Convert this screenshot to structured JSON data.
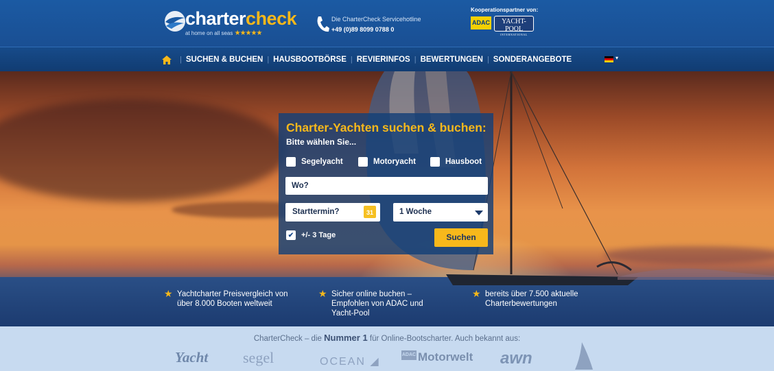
{
  "header": {
    "logo_text_1": "charter",
    "logo_text_2": "check",
    "logo_tagline": "at home on all seas",
    "logo_stars": "★★★★★",
    "hotline_label": "Die CharterCheck Servicehotline",
    "hotline_number": "+49 (0)89 8099 0788 0",
    "partners_label": "Kooperationspartner von:",
    "partner_adac": "ADAC",
    "partner_yachtpool": "YACHT-POOL",
    "partner_yachtpool_sub": "INTERNATIONAL"
  },
  "nav": {
    "items": [
      "SUCHEN & BUCHEN",
      "HAUSBOOTBÖRSE",
      "REVIERINFOS",
      "BEWERTUNGEN",
      "SONDERANGEBOTE"
    ],
    "language_caret": "▾"
  },
  "search": {
    "title": "Charter-Yachten suchen & buchen:",
    "subtitle": "Bitte wählen Sie...",
    "types": [
      "Segelyacht",
      "Motoryacht",
      "Hausboot"
    ],
    "where_placeholder": "Wo?",
    "start_placeholder": "Starttermin?",
    "calendar_day": "31",
    "duration_value": "1 Woche",
    "flex_label": "+/- 3 Tage",
    "flex_checked": true,
    "submit_label": "Suchen"
  },
  "features": [
    {
      "text": "Yachtcharter Preisvergleich von über 8.000 Booten weltweit"
    },
    {
      "text": "Sicher online buchen – Empfohlen von ADAC und Yacht-Pool"
    },
    {
      "text": "bereits über 7.500 aktuelle Charterbewertungen"
    }
  ],
  "press": {
    "prefix": "CharterCheck – die ",
    "highlight": "Nummer 1",
    "suffix": " für Online-Bootscharter. Auch bekannt aus:",
    "logos": [
      "Yacht",
      "segel",
      "OCEAN",
      "ADAC",
      "Motorwelt",
      "awn"
    ]
  },
  "colors": {
    "brand_blue": "#1b5aa3",
    "accent_yellow": "#f7b81b",
    "nav_blue": "#113c72",
    "press_bg": "#c7daf0"
  }
}
